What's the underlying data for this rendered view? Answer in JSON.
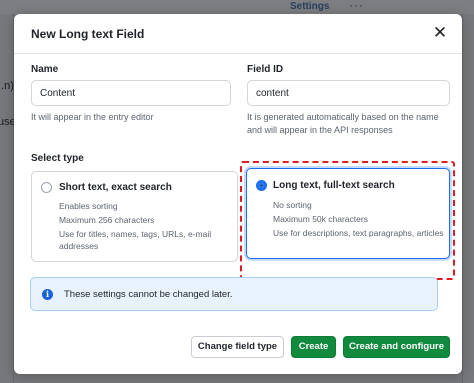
{
  "background": {
    "settings_label": "Settings",
    "more_label": "···",
    "fragments": [
      "..n)",
      "use"
    ]
  },
  "modal": {
    "title": "New Long text Field",
    "close_label": "✕"
  },
  "name_field": {
    "label": "Name",
    "value": "Content",
    "help": "It will appear in the entry editor"
  },
  "id_field": {
    "label": "Field ID",
    "value": "content",
    "help_lines": [
      "It is generated automatically based on the name",
      "and will appear in the API responses"
    ]
  },
  "select_type": {
    "label": "Select type",
    "options": [
      {
        "title": "Short text, exact search",
        "selected": false,
        "lines": [
          "Enables sorting",
          "Maximum 256 characters",
          "Use for titles, names, tags, URLs, e-mail",
          "addresses"
        ]
      },
      {
        "title": "Long text, full-text search",
        "selected": true,
        "lines": [
          "No sorting",
          "Maximum 50k characters",
          "Use for descriptions, text paragraphs, articles"
        ]
      }
    ]
  },
  "notice": {
    "icon": "info-icon",
    "icon_glyph": "i",
    "text": "These settings cannot be changed later."
  },
  "footer": {
    "change_type_label": "Change field type",
    "create_label": "Create",
    "create_configure_label": "Create and configure"
  },
  "colors": {
    "primary_green": "#118a3e",
    "selection_blue": "#1b6ff0",
    "highlight_red": "#e01b24",
    "notice_bg": "#e8f2fd"
  }
}
